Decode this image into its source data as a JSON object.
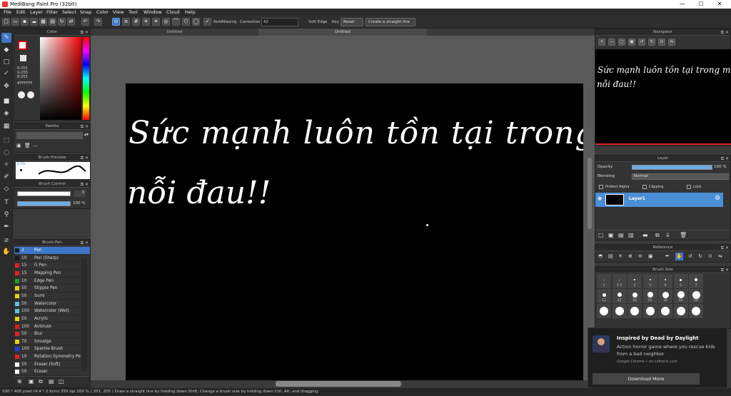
{
  "window": {
    "title": "MediBang Paint Pro (32bit)",
    "controls": [
      "—",
      "☐",
      "✕"
    ]
  },
  "menu": [
    "File",
    "Edit",
    "Layer",
    "Filter",
    "Select",
    "Snap",
    "Color",
    "View",
    "Tool",
    "Window",
    "Cloud",
    "Help"
  ],
  "toolbar": {
    "antialiasing": "AntiAliasing",
    "correction_label": "Correction",
    "correction_value": "42",
    "soft_edge": "Soft Edge",
    "key_label": "Key",
    "reset": "Reset",
    "straight_line": "Create a straight line"
  },
  "tabs": {
    "left": "Untitled",
    "right": "Untitled"
  },
  "color_panel": {
    "title": "Color",
    "r": "R:255",
    "g": "G:255",
    "b": "B:255",
    "hex": "#FFFFFF",
    "primary": "#ffffff",
    "secondary": "#000000"
  },
  "palette": {
    "title": "Palette",
    "placeholder": "---"
  },
  "brush_preview": {
    "title": "Brush Preview",
    "size": "0.72r"
  },
  "brush_control": {
    "title": "Brush Control",
    "size_value": "3",
    "opacity_value": "100 %"
  },
  "brush_list": {
    "title": "Brush Pen",
    "items": [
      {
        "size": "3",
        "name": "Pen",
        "color": "#1a1a1a",
        "selected": true
      },
      {
        "size": "10",
        "name": "Pen (Sharp)",
        "color": "#1a1a1a"
      },
      {
        "size": "15",
        "name": "G Pen",
        "color": "#e02020"
      },
      {
        "size": "15",
        "name": "Mapping Pen",
        "color": "#e02020"
      },
      {
        "size": "10",
        "name": "Edge Pen",
        "color": "#20a020"
      },
      {
        "size": "50",
        "name": "Stipple Pen",
        "color": "#e0d020"
      },
      {
        "size": "50",
        "name": "Sumi",
        "color": "#e0d020"
      },
      {
        "size": "50",
        "name": "Watercolor",
        "color": "#60c0e0"
      },
      {
        "size": "100",
        "name": "Watercolor (Wet)",
        "color": "#60c0e0"
      },
      {
        "size": "50",
        "name": "Acrylic",
        "color": "#e0d020"
      },
      {
        "size": "100",
        "name": "Airbrush",
        "color": "#e02020"
      },
      {
        "size": "50",
        "name": "Blur",
        "color": "#e02020"
      },
      {
        "size": "70",
        "name": "Smudge",
        "color": "#e0d020"
      },
      {
        "size": "100",
        "name": "Sparkle Brush",
        "color": "#2040e0"
      },
      {
        "size": "10",
        "name": "Rotation Symmetry Pe",
        "color": "#e02020"
      },
      {
        "size": "50",
        "name": "Eraser (Soft)",
        "color": "#ffffff"
      },
      {
        "size": "50",
        "name": "Eraser",
        "color": "#ffffff"
      }
    ]
  },
  "canvas_text": {
    "line1": "Sức mạnh luôn tồn tại trong mọi",
    "line2": "nỗi đau!!"
  },
  "navigator": {
    "title": "Navigator",
    "line1": "Sức mạnh luôn tồn tại trong mọi",
    "line2": "nỗi đau!!"
  },
  "layer": {
    "title": "Layer",
    "opacity_label": "Opacity",
    "opacity_value": "100 %",
    "blending_label": "Blending",
    "blending_value": "Normal",
    "protect_alpha": "Protect Alpha",
    "clipping": "Clipping",
    "lock": "Lock",
    "layer_name": "Layer1"
  },
  "reference": {
    "title": "Reference"
  },
  "brush_size": {
    "title": "Brush Size",
    "rows": [
      [
        "1",
        "1.5",
        "2",
        "3",
        "4",
        "5",
        "7"
      ],
      [
        "12",
        "15",
        "20",
        "25",
        "30",
        "40",
        "50"
      ],
      [
        "",
        "",
        "",
        "",
        "",
        "",
        ""
      ]
    ]
  },
  "notification": {
    "title": "Inspired by Dead by Daylight",
    "body": "Action horror game where you rescue kids from a bad neighbor",
    "source": "Google Chrome • en.softonic.com",
    "button": "Download More"
  },
  "status": "500 * 400 pixel   (4.4 * 2.9cm)   350 dpi   200 %   ( 201, 205 )   Draw a straight line by holding down Shift, Change a brush size by holding down Ctrl, Alt, and dragging"
}
